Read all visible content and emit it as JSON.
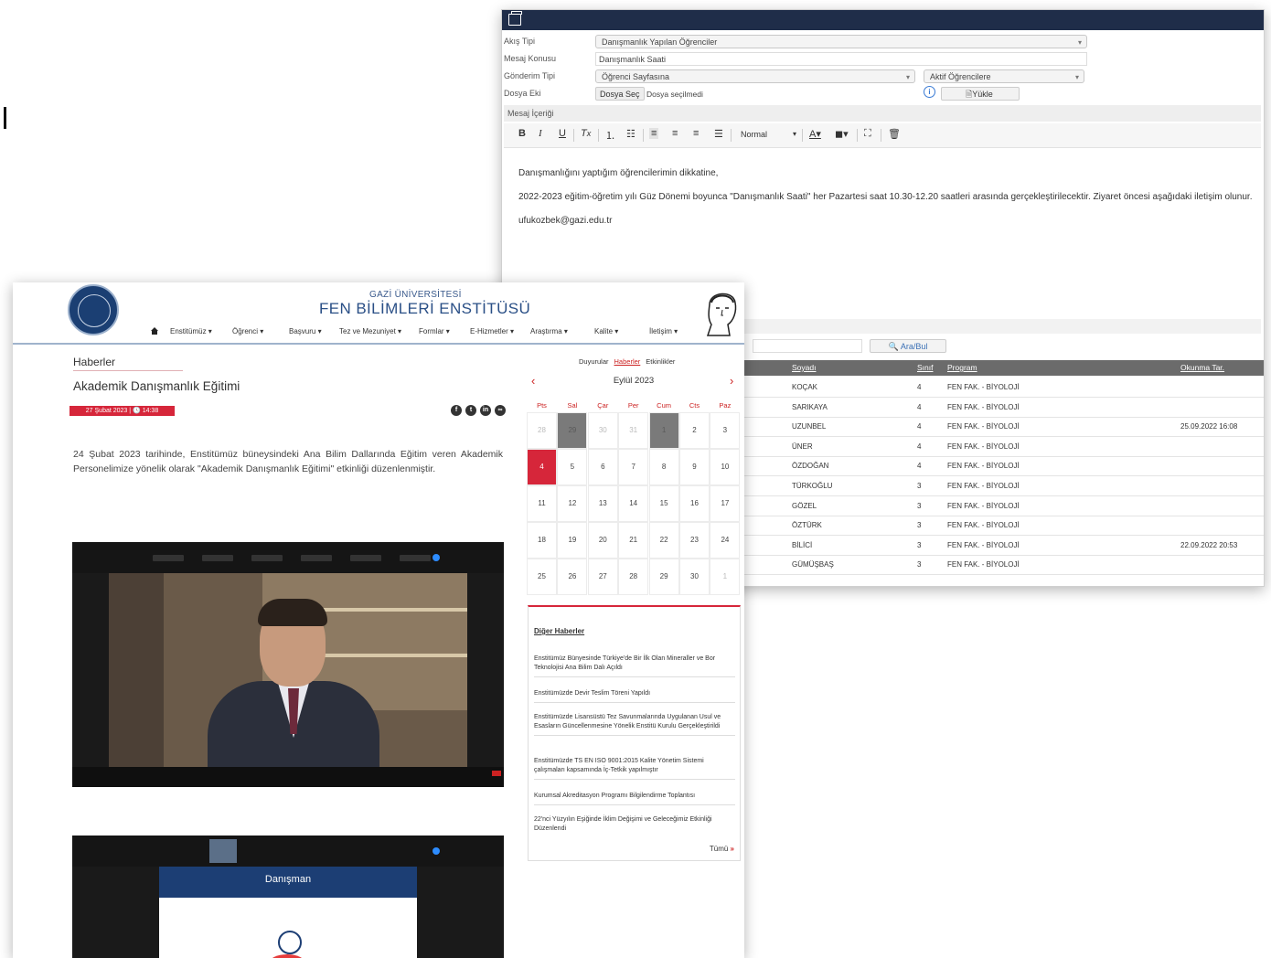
{
  "messaging": {
    "fields": {
      "akis_tipi": {
        "label": "Akış Tipi",
        "value": "Danışmanlık Yapılan Öğrenciler"
      },
      "mesaj_konusu": {
        "label": "Mesaj Konusu",
        "value": "Danışmanlık Saati"
      },
      "gonderim_tipi": {
        "label": "Gönderim Tipi",
        "value": "Öğrenci Sayfasına",
        "value2": "Aktif Öğrencilere"
      },
      "dosya_eki": {
        "label": "Dosya Eki",
        "choose": "Dosya Seç",
        "status": "Dosya seçilmedi",
        "upload": "Yükle"
      }
    },
    "editor": {
      "header": "Mesaj İçeriği",
      "format": "Normal",
      "toolbar": [
        "B",
        "I",
        "U",
        "Tx",
        "≡",
        "☰",
        "⯇",
        "≡",
        "≡",
        "≡",
        "A",
        "◼",
        "⛶",
        "🗑"
      ],
      "paragraphs": [
        "Danışmanlığını yaptığım öğrencilerimin dikkatine,",
        "2022-2023 eğitim-öğretim yılı Güz Dönemi boyunca \"Danışmanlık Saati\" her Pazartesi saat 10.30-12.20 saatleri arasında gerçekleştirilecektir. Ziyaret öncesi aşağıdaki iletişim olunur.",
        "ufukozbek@gazi.edu.tr"
      ]
    },
    "search_button": "Ara/Bul",
    "grid": {
      "columns": [
        "Soyadı",
        "Sınıf",
        "Program",
        "Okunma Tar."
      ],
      "rows": [
        [
          "KOÇAK",
          "4",
          "FEN FAK. - BİYOLOJİ",
          ""
        ],
        [
          "SARIKAYA",
          "4",
          "FEN FAK. - BİYOLOJİ",
          ""
        ],
        [
          "UZUNBEL",
          "4",
          "FEN FAK. - BİYOLOJİ",
          "25.09.2022 16:08"
        ],
        [
          "ÜNER",
          "4",
          "FEN FAK. - BİYOLOJİ",
          ""
        ],
        [
          "ÖZDOĞAN",
          "4",
          "FEN FAK. - BİYOLOJİ",
          ""
        ],
        [
          "TÜRKOĞLU",
          "3",
          "FEN FAK. - BİYOLOJİ",
          ""
        ],
        [
          "GÖZEL",
          "3",
          "FEN FAK. - BİYOLOJİ",
          ""
        ],
        [
          "ÖZTÜRK",
          "3",
          "FEN FAK. - BİYOLOJİ",
          ""
        ],
        [
          "BİLİCİ",
          "3",
          "FEN FAK. - BİYOLOJİ",
          "22.09.2022 20:53"
        ],
        [
          "GÜMÜŞBAŞ",
          "3",
          "FEN FAK. - BİYOLOJİ",
          ""
        ]
      ]
    }
  },
  "site": {
    "university": "GAZİ ÜNİVERSİTESİ",
    "institute": "FEN BİLİMLERİ ENSTİTÜSÜ",
    "nav": [
      "Enstitümüz ▾",
      "Öğrenci ▾",
      "Başvuru ▾",
      "Tez ve Mezuniyet ▾",
      "Formlar ▾",
      "E-Hizmetler ▾",
      "Araştırma ▾",
      "Kalite ▾",
      "İletişim ▾"
    ],
    "breadcrumb": "Haberler",
    "tabs": [
      "Duyurular",
      "Haberler",
      "Etkinlikler"
    ],
    "article": {
      "title": "Akademik Danışmanlık Eğitimi",
      "date": "27 Şubat 2023 | 🕓 14:38",
      "body": "24 Şubat 2023 tarihinde, Enstitümüz büneysindeki Ana Bilim Dallarında Eğitim veren Akademik Personelimize yönelik olarak \"Akademik Danışmanlık Eğitimi\" etkinliği düzenlenmiştir.",
      "slide_title": "Danışman"
    },
    "calendar": {
      "month": "Eylül 2023",
      "days": [
        "Pts",
        "Sal",
        "Çar",
        "Per",
        "Cum",
        "Cts",
        "Paz"
      ],
      "weeks": [
        [
          "28",
          "29",
          "30",
          "31",
          "1",
          "2",
          "3"
        ],
        [
          "4",
          "5",
          "6",
          "7",
          "8",
          "9",
          "10"
        ],
        [
          "11",
          "12",
          "13",
          "14",
          "15",
          "16",
          "17"
        ],
        [
          "18",
          "19",
          "20",
          "21",
          "22",
          "23",
          "24"
        ],
        [
          "25",
          "26",
          "27",
          "28",
          "29",
          "30",
          "1"
        ]
      ]
    },
    "other_news": {
      "title": "Diğer Haberler",
      "items": [
        "Enstitümüz Bünyesinde Türkiye'de Bir İlk Olan Mineraller ve Bor Teknolojisi Ana Bilim Dalı Açıldı",
        "Enstitümüzde Devir Teslim Töreni Yapıldı",
        "Enstitümüzde Lisansüstü Tez Savunmalarında Uygulanan Usul ve Esasların Güncellenmesine Yönelik Enstitü Kurulu Gerçekleştirildi",
        "Enstitümüzde TS EN ISO 9001:2015 Kalite Yönetim Sistemi çalışmaları kapsamında İç-Tetkik yapılmıştır",
        "Kurumsal Akreditasyon Programı Bilgilendirme Toplantısı",
        "22'nci Yüzyılın Eşiğinde İklim Değişimi ve Geleceğimiz Etkinliği Düzenlendi"
      ],
      "more": "Tümü"
    },
    "colors": {
      "accent": "#d6263a",
      "brand": "#2a4f86"
    }
  }
}
